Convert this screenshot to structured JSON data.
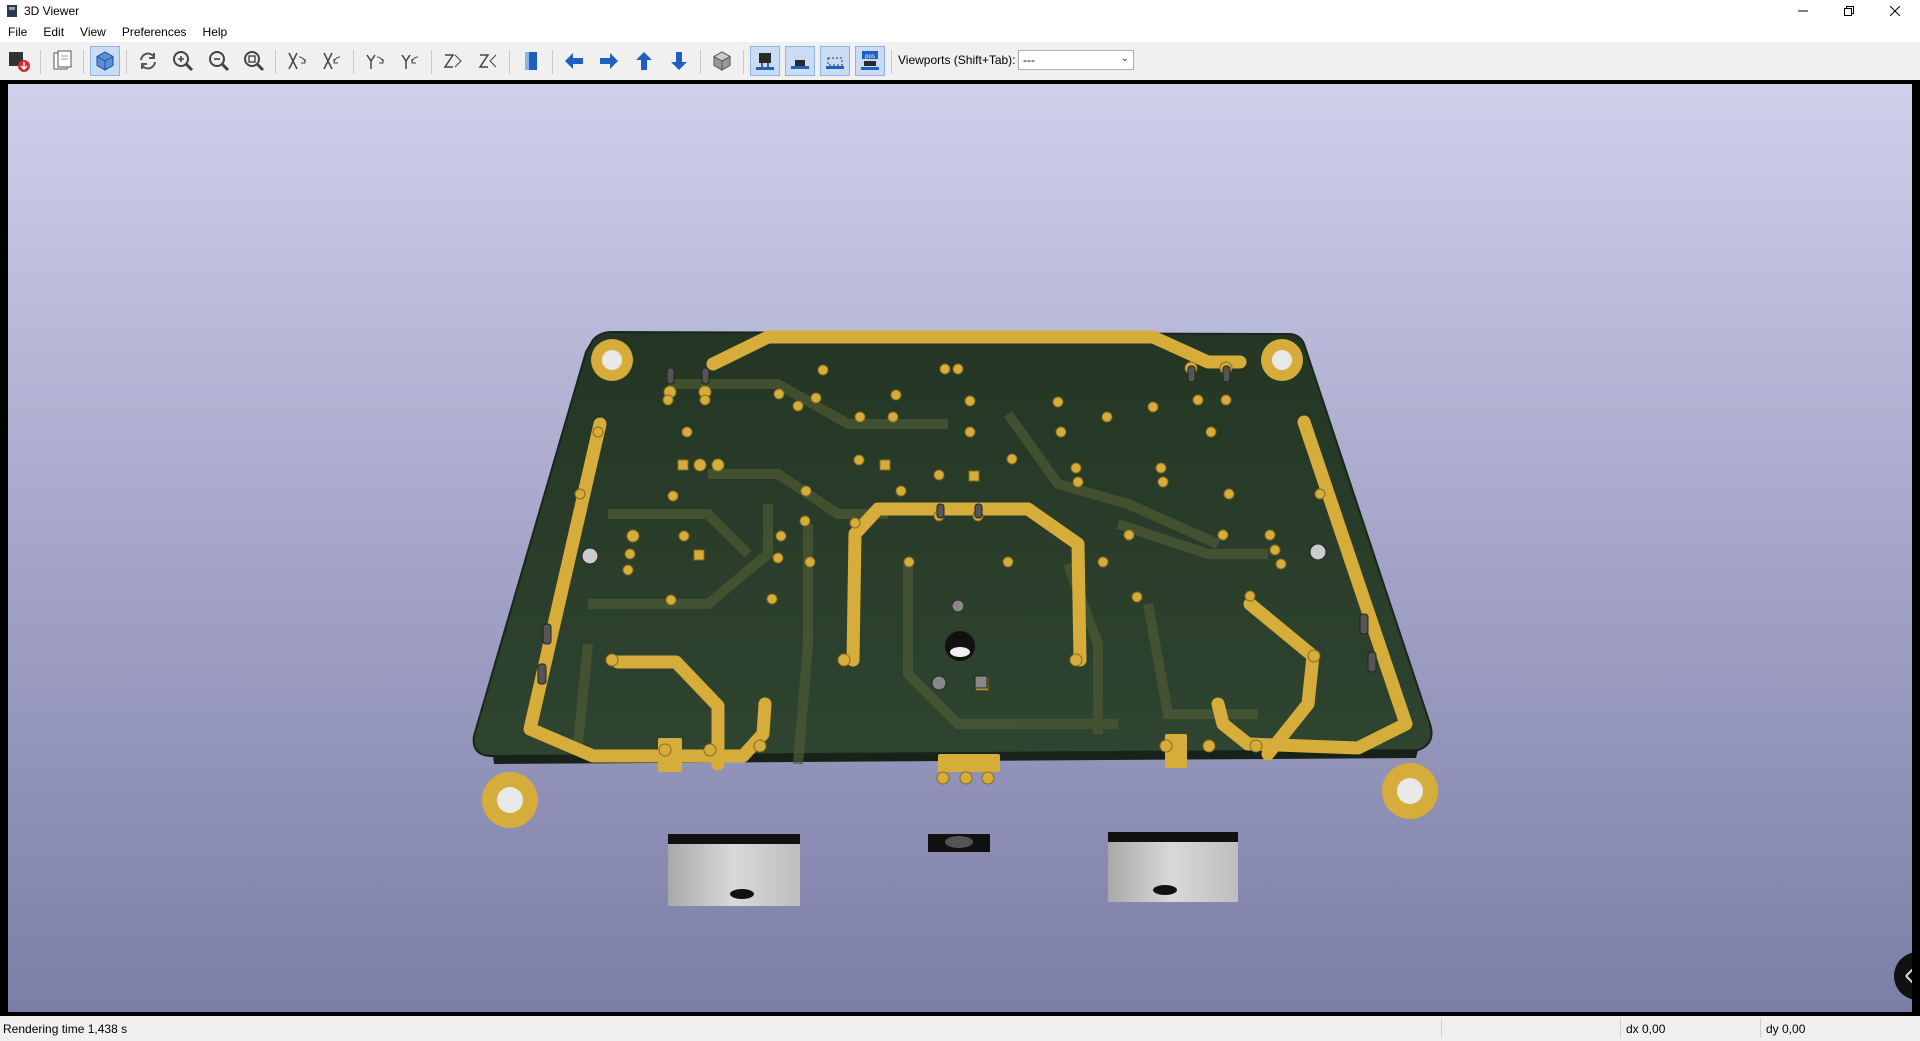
{
  "window": {
    "title": "3D Viewer"
  },
  "menu": [
    "File",
    "Edit",
    "View",
    "Preferences",
    "Help"
  ],
  "toolbar": {
    "buttons": [
      "export-image-icon",
      "copy-clipboard-icon",
      "raytrace-icon",
      "reload-icon",
      "zoom-in-icon",
      "zoom-out-icon",
      "zoom-fit-icon",
      "rotate-x-cw-icon",
      "rotate-x-ccw-icon",
      "rotate-y-cw-icon",
      "rotate-y-ccw-icon",
      "rotate-z-cw-icon",
      "rotate-z-ccw-icon",
      "flip-board-icon",
      "move-left-icon",
      "move-right-icon",
      "move-up-icon",
      "move-down-icon",
      "ortho-view-icon",
      "show-tht-icon",
      "show-smd-icon",
      "show-virtual-icon",
      "show-pos-icon"
    ],
    "viewports_label": "Viewports (Shift+Tab):",
    "viewports_value": "---",
    "colors": {
      "accent": "#1f5fbf",
      "active_bg": "#c9dcf3"
    }
  },
  "status": {
    "rendering_time": "Rendering time 1,438 s",
    "dx": "dx 0,00",
    "dy": "dy 0,00"
  },
  "scene": {
    "board_color": "#2b3e2a",
    "copper_color": "#d6ad3a",
    "background_top": "#cfd0ea",
    "background_bottom": "#7b7ea7"
  }
}
